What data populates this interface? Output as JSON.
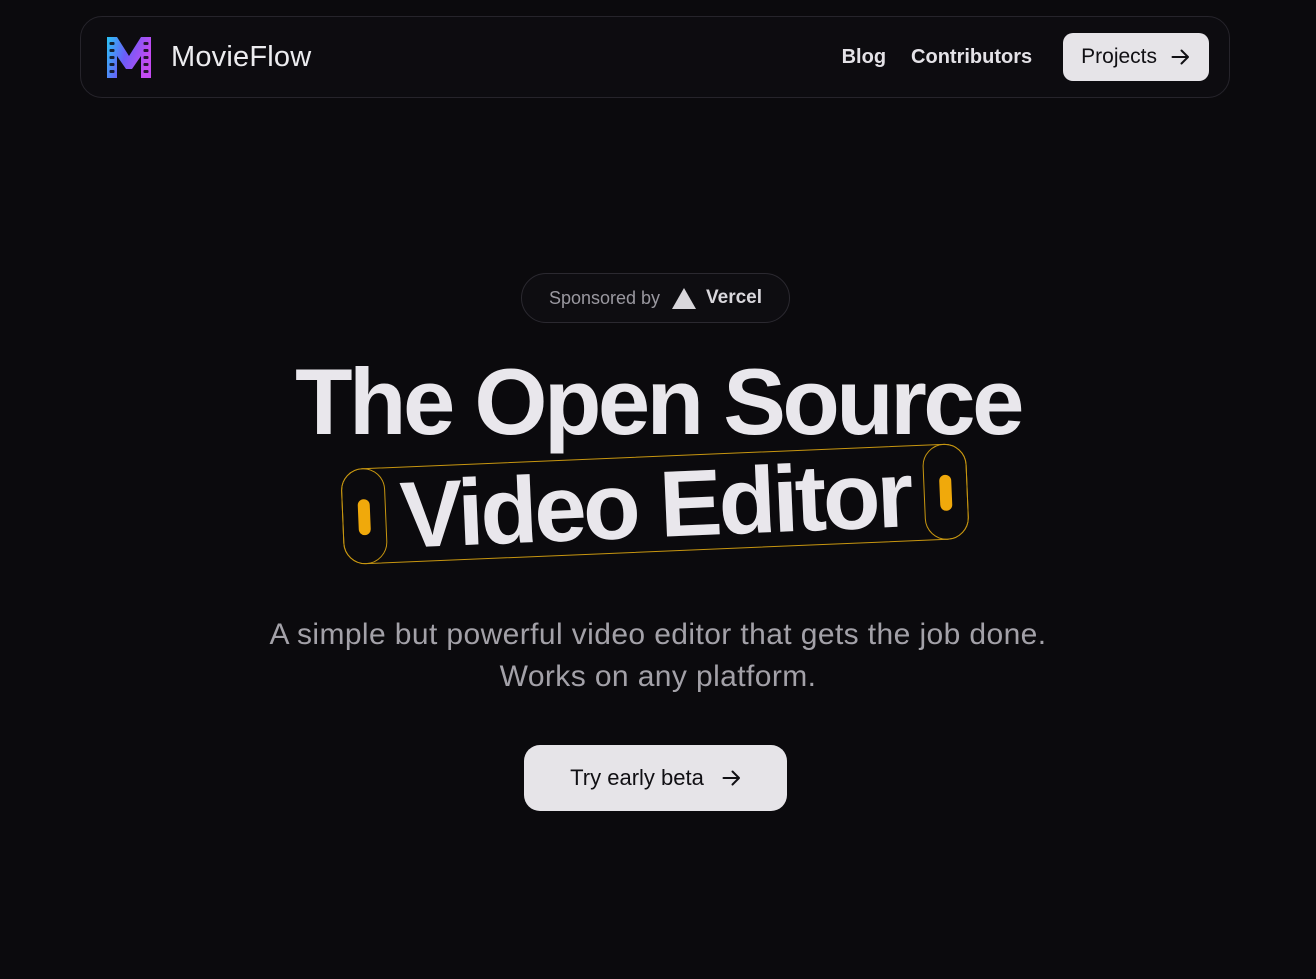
{
  "header": {
    "brand_name": "MovieFlow",
    "logo_icon": "movieflow-m-logo",
    "nav": [
      {
        "label": "Blog"
      },
      {
        "label": "Contributors"
      }
    ],
    "projects_button": {
      "label": "Projects",
      "icon": "arrow-right-icon"
    }
  },
  "hero": {
    "sponsor": {
      "label": "Sponsored by",
      "brand_icon": "vercel-triangle-icon",
      "brand": "Vercel"
    },
    "headline_line1": "The Open Source",
    "headline_line2": "Video Editor",
    "subtitle_line1": "A simple but powerful video editor that gets the job done.",
    "subtitle_line2": "Works on any platform.",
    "cta_button": {
      "label": "Try early beta",
      "icon": "arrow-right-icon"
    }
  },
  "colors": {
    "background": "#0b0a0d",
    "text": "#e9e7ec",
    "muted_text": "#a3a1a8",
    "button_bg": "#e6e4e8",
    "accent_yellow": "#f0a90b",
    "logo_gradient": [
      "#29c4f5",
      "#6b5cf7",
      "#c34bf2"
    ]
  }
}
